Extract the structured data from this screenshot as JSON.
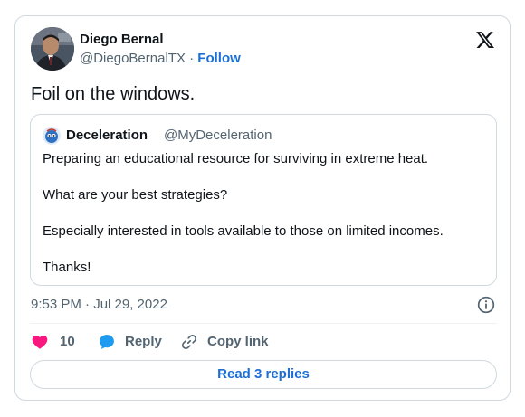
{
  "author": {
    "name": "Diego Bernal",
    "handle": "@DiegoBernalTX",
    "separator": "·",
    "follow_label": "Follow"
  },
  "tweet": {
    "text": "Foil on the windows.",
    "timestamp": "9:53 PM · Jul 29, 2022"
  },
  "quoted": {
    "name": "Deceleration",
    "handle": "@MyDeceleration",
    "lines": [
      "Preparing an educational resource for surviving in extreme heat.",
      "What are your best strategies?",
      "Especially interested in tools available to those on limited incomes.",
      "Thanks!"
    ]
  },
  "actions": {
    "like_count": "10",
    "reply_label": "Reply",
    "copy_label": "Copy link"
  },
  "read_replies_label": "Read 3 replies",
  "icons": {
    "brand": "x-logo-icon",
    "like": "heart-icon",
    "reply": "speech-bubble-icon",
    "copy": "link-icon",
    "info": "info-icon"
  },
  "colors": {
    "accent": "#1d6fd6",
    "like": "#f91880",
    "text": "#0f1419",
    "muted": "#536471",
    "border": "#cfd9de"
  }
}
